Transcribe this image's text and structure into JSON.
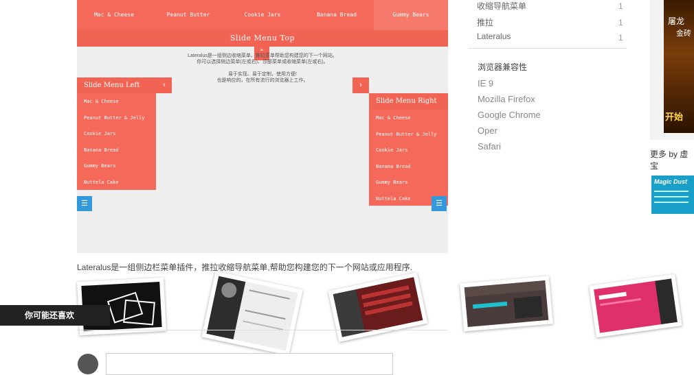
{
  "demo": {
    "top_menu_items": [
      "Mac & Cheese",
      "Peanut Butter",
      "Cookie Jars",
      "Banana Bread",
      "Gummy Bears"
    ],
    "slide_top_title": "Slide Menu Top",
    "desc_lines": [
      "Lateralus是一组侧边收缩菜单、推拉菜单帮助您构建您的下一个网站。",
      "你可以选择侧边菜单(左或右)、顶部菜单或收缩菜单(左或右)。",
      "",
      "易于实现、易于定制，使用方便!",
      "也是响应的，在所有流行的浏览器上工作。"
    ],
    "left_title": "Slide Menu Left",
    "right_title": "Slide Menu Right",
    "side_items": [
      "Mac & Cheese",
      "Peanut Butter & Jelly",
      "Cookie Jars",
      "Banana Bread",
      "Gummy Bears",
      "Nuttela Cake"
    ],
    "icons": {
      "top_toggle": "chevron-up-icon",
      "left_close": "chevron-left-icon",
      "right_toggle": "chevron-right-icon",
      "list": "list-icon"
    },
    "accent": "#f4695a",
    "toggle_blue": "#3498db"
  },
  "caption": "Lateralus是一组侧边栏菜单插件，推拉收缩导航菜单,帮助您构建您的下一个网站或应用程序.",
  "related_label": "你可能还喜欢",
  "sidebar": {
    "tags": [
      {
        "name": "收缩导航菜单",
        "count": "1"
      },
      {
        "name": "推拉",
        "count": "1"
      },
      {
        "name": "Lateralus",
        "count": "1"
      }
    ],
    "compat_title": "浏览器兼容性",
    "browsers": [
      "IE 9",
      "Mozilla Firefox",
      "Google Chrome",
      "Oper",
      "Safari"
    ],
    "more_text": "更多 by 虚宝",
    "magic_text": "Magic Dust",
    "ad_text_top": "屠龙",
    "ad_text_mid": "金砖",
    "ad_text_btn": "开始"
  }
}
